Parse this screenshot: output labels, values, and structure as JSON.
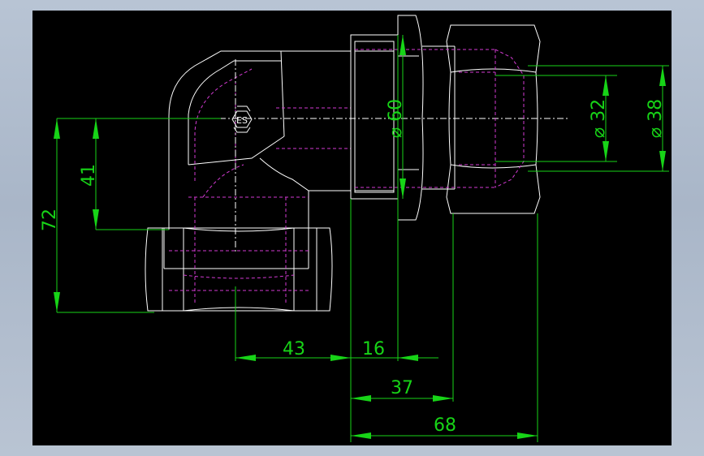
{
  "drawing": {
    "background": "#000000",
    "frame_color": "#b4c0d0",
    "outline_color": "#ffffff",
    "hidden_line_color": "#d23ad2",
    "dimension_color": "#17d417",
    "symbol_text": "ES"
  },
  "dimensions": {
    "dim_72": "72",
    "dim_41": "41",
    "dim_43": "43",
    "dim_16": "16",
    "dim_37": "37",
    "dim_68": "68",
    "dim_dia60": "⌀ 60",
    "dim_dia32": "⌀ 32",
    "dim_dia38": "⌀ 38"
  }
}
